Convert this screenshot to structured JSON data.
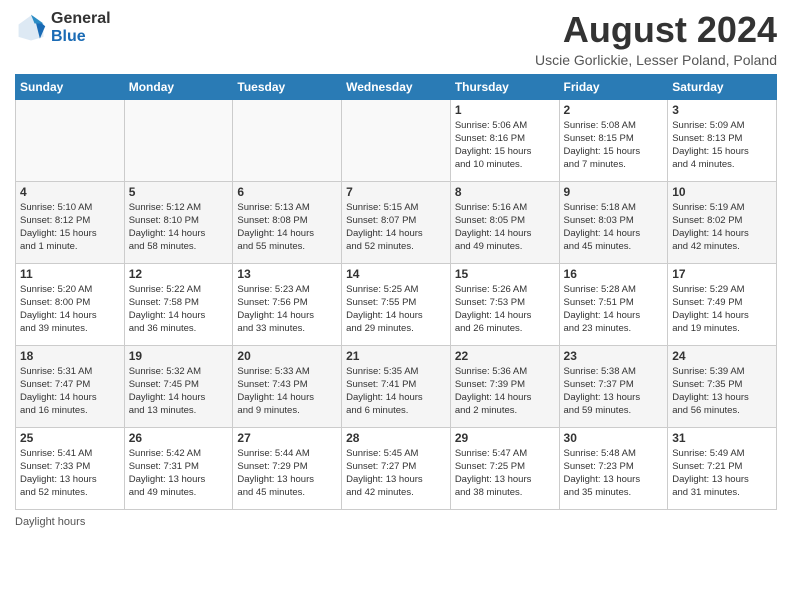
{
  "logo": {
    "general": "General",
    "blue": "Blue"
  },
  "title": "August 2024",
  "subtitle": "Uscie Gorlickie, Lesser Poland, Poland",
  "days_of_week": [
    "Sunday",
    "Monday",
    "Tuesday",
    "Wednesday",
    "Thursday",
    "Friday",
    "Saturday"
  ],
  "weeks": [
    [
      {
        "day": "",
        "info": ""
      },
      {
        "day": "",
        "info": ""
      },
      {
        "day": "",
        "info": ""
      },
      {
        "day": "",
        "info": ""
      },
      {
        "day": "1",
        "info": "Sunrise: 5:06 AM\nSunset: 8:16 PM\nDaylight: 15 hours\nand 10 minutes."
      },
      {
        "day": "2",
        "info": "Sunrise: 5:08 AM\nSunset: 8:15 PM\nDaylight: 15 hours\nand 7 minutes."
      },
      {
        "day": "3",
        "info": "Sunrise: 5:09 AM\nSunset: 8:13 PM\nDaylight: 15 hours\nand 4 minutes."
      }
    ],
    [
      {
        "day": "4",
        "info": "Sunrise: 5:10 AM\nSunset: 8:12 PM\nDaylight: 15 hours\nand 1 minute."
      },
      {
        "day": "5",
        "info": "Sunrise: 5:12 AM\nSunset: 8:10 PM\nDaylight: 14 hours\nand 58 minutes."
      },
      {
        "day": "6",
        "info": "Sunrise: 5:13 AM\nSunset: 8:08 PM\nDaylight: 14 hours\nand 55 minutes."
      },
      {
        "day": "7",
        "info": "Sunrise: 5:15 AM\nSunset: 8:07 PM\nDaylight: 14 hours\nand 52 minutes."
      },
      {
        "day": "8",
        "info": "Sunrise: 5:16 AM\nSunset: 8:05 PM\nDaylight: 14 hours\nand 49 minutes."
      },
      {
        "day": "9",
        "info": "Sunrise: 5:18 AM\nSunset: 8:03 PM\nDaylight: 14 hours\nand 45 minutes."
      },
      {
        "day": "10",
        "info": "Sunrise: 5:19 AM\nSunset: 8:02 PM\nDaylight: 14 hours\nand 42 minutes."
      }
    ],
    [
      {
        "day": "11",
        "info": "Sunrise: 5:20 AM\nSunset: 8:00 PM\nDaylight: 14 hours\nand 39 minutes."
      },
      {
        "day": "12",
        "info": "Sunrise: 5:22 AM\nSunset: 7:58 PM\nDaylight: 14 hours\nand 36 minutes."
      },
      {
        "day": "13",
        "info": "Sunrise: 5:23 AM\nSunset: 7:56 PM\nDaylight: 14 hours\nand 33 minutes."
      },
      {
        "day": "14",
        "info": "Sunrise: 5:25 AM\nSunset: 7:55 PM\nDaylight: 14 hours\nand 29 minutes."
      },
      {
        "day": "15",
        "info": "Sunrise: 5:26 AM\nSunset: 7:53 PM\nDaylight: 14 hours\nand 26 minutes."
      },
      {
        "day": "16",
        "info": "Sunrise: 5:28 AM\nSunset: 7:51 PM\nDaylight: 14 hours\nand 23 minutes."
      },
      {
        "day": "17",
        "info": "Sunrise: 5:29 AM\nSunset: 7:49 PM\nDaylight: 14 hours\nand 19 minutes."
      }
    ],
    [
      {
        "day": "18",
        "info": "Sunrise: 5:31 AM\nSunset: 7:47 PM\nDaylight: 14 hours\nand 16 minutes."
      },
      {
        "day": "19",
        "info": "Sunrise: 5:32 AM\nSunset: 7:45 PM\nDaylight: 14 hours\nand 13 minutes."
      },
      {
        "day": "20",
        "info": "Sunrise: 5:33 AM\nSunset: 7:43 PM\nDaylight: 14 hours\nand 9 minutes."
      },
      {
        "day": "21",
        "info": "Sunrise: 5:35 AM\nSunset: 7:41 PM\nDaylight: 14 hours\nand 6 minutes."
      },
      {
        "day": "22",
        "info": "Sunrise: 5:36 AM\nSunset: 7:39 PM\nDaylight: 14 hours\nand 2 minutes."
      },
      {
        "day": "23",
        "info": "Sunrise: 5:38 AM\nSunset: 7:37 PM\nDaylight: 13 hours\nand 59 minutes."
      },
      {
        "day": "24",
        "info": "Sunrise: 5:39 AM\nSunset: 7:35 PM\nDaylight: 13 hours\nand 56 minutes."
      }
    ],
    [
      {
        "day": "25",
        "info": "Sunrise: 5:41 AM\nSunset: 7:33 PM\nDaylight: 13 hours\nand 52 minutes."
      },
      {
        "day": "26",
        "info": "Sunrise: 5:42 AM\nSunset: 7:31 PM\nDaylight: 13 hours\nand 49 minutes."
      },
      {
        "day": "27",
        "info": "Sunrise: 5:44 AM\nSunset: 7:29 PM\nDaylight: 13 hours\nand 45 minutes."
      },
      {
        "day": "28",
        "info": "Sunrise: 5:45 AM\nSunset: 7:27 PM\nDaylight: 13 hours\nand 42 minutes."
      },
      {
        "day": "29",
        "info": "Sunrise: 5:47 AM\nSunset: 7:25 PM\nDaylight: 13 hours\nand 38 minutes."
      },
      {
        "day": "30",
        "info": "Sunrise: 5:48 AM\nSunset: 7:23 PM\nDaylight: 13 hours\nand 35 minutes."
      },
      {
        "day": "31",
        "info": "Sunrise: 5:49 AM\nSunset: 7:21 PM\nDaylight: 13 hours\nand 31 minutes."
      }
    ]
  ],
  "footer": "Daylight hours"
}
